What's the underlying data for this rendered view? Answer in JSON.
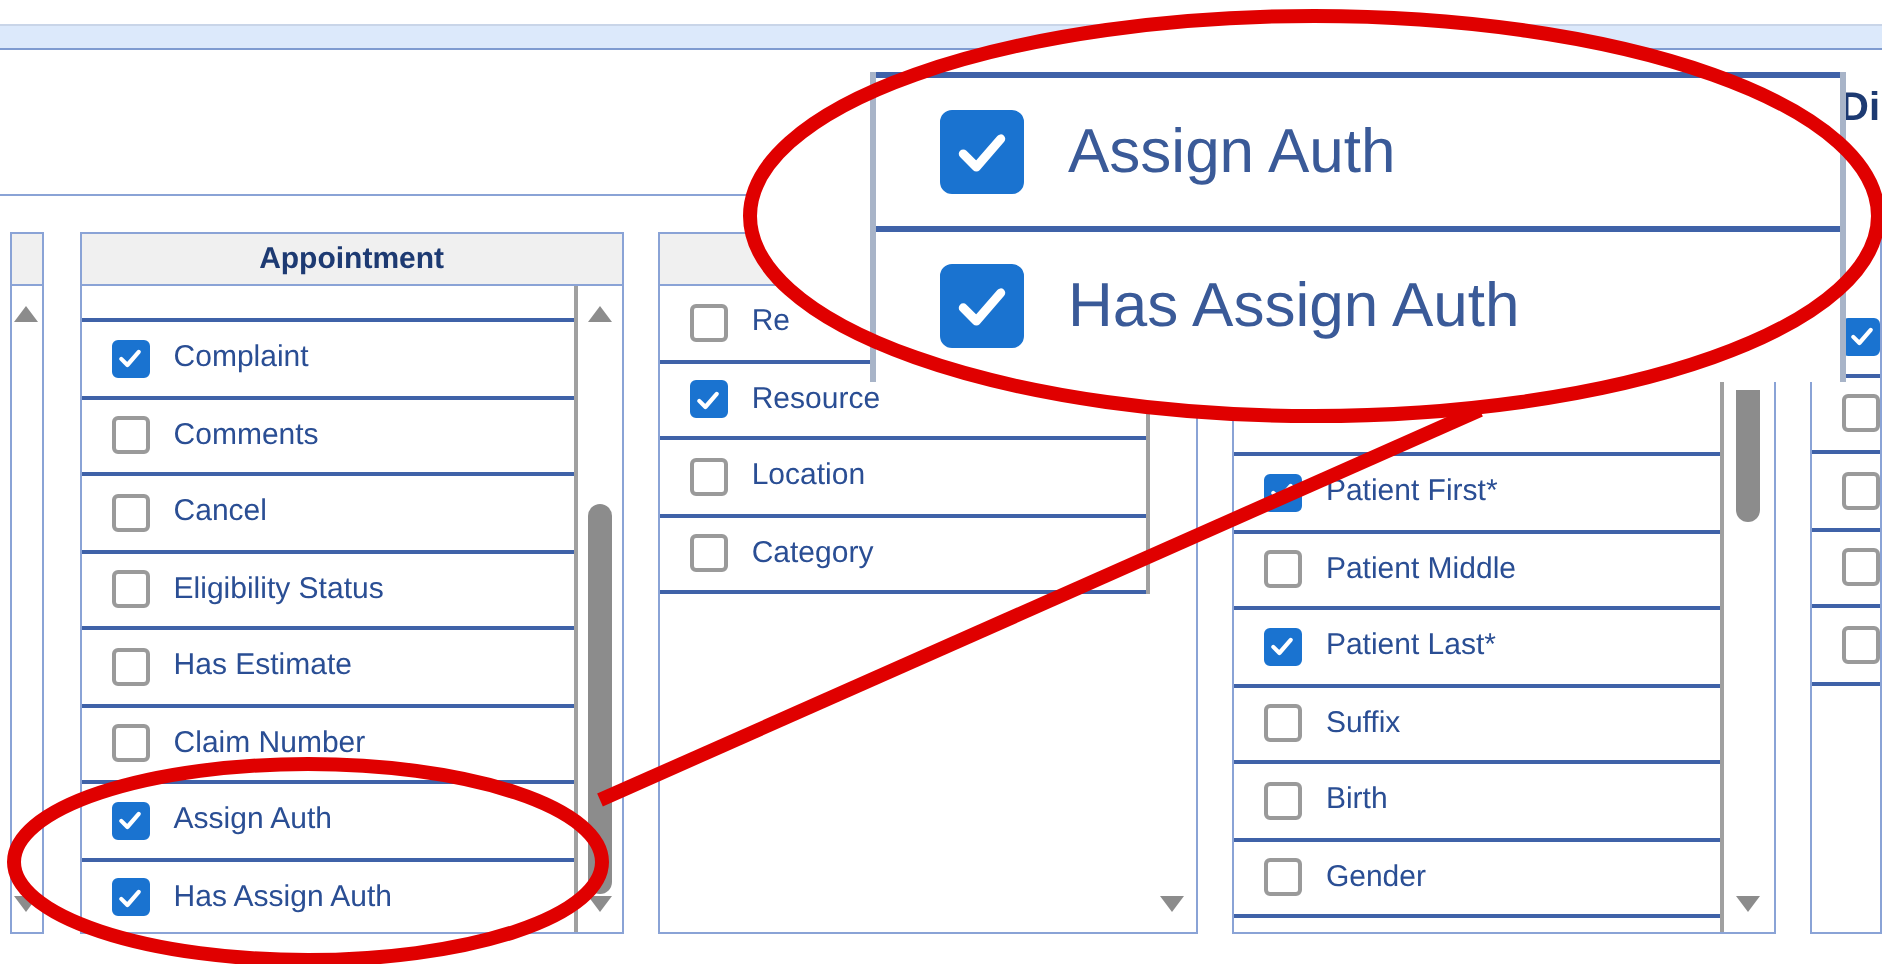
{
  "top_right_label": "Di",
  "appointment": {
    "title": "Appointment",
    "items": [
      {
        "label": "Complaint",
        "checked": true
      },
      {
        "label": "Comments",
        "checked": false
      },
      {
        "label": "Cancel",
        "checked": false
      },
      {
        "label": "Eligibility Status",
        "checked": false
      },
      {
        "label": "Has Estimate",
        "checked": false
      },
      {
        "label": "Claim Number",
        "checked": false
      },
      {
        "label": "Assign Auth",
        "checked": true
      },
      {
        "label": "Has Assign Auth",
        "checked": true
      }
    ]
  },
  "panel_3": {
    "items": [
      {
        "label": "Re",
        "checked": false
      },
      {
        "label": "Resource",
        "checked": true
      },
      {
        "label": "Location",
        "checked": false
      },
      {
        "label": "Category",
        "checked": false
      }
    ]
  },
  "panel_4": {
    "items": [
      {
        "label": "Patient First*",
        "checked": true
      },
      {
        "label": "Patient Middle",
        "checked": false
      },
      {
        "label": "Patient Last*",
        "checked": true
      },
      {
        "label": "Suffix",
        "checked": false
      },
      {
        "label": "Birth",
        "checked": false
      },
      {
        "label": "Gender",
        "checked": false
      }
    ]
  },
  "panel_5": {
    "items": [
      {
        "checked": true
      },
      {
        "checked": false
      },
      {
        "checked": false
      },
      {
        "checked": false
      },
      {
        "checked": false
      }
    ]
  },
  "magnified": {
    "items": [
      {
        "label": "Assign Auth",
        "checked": true
      },
      {
        "label": "Has Assign Auth",
        "checked": true
      }
    ]
  }
}
